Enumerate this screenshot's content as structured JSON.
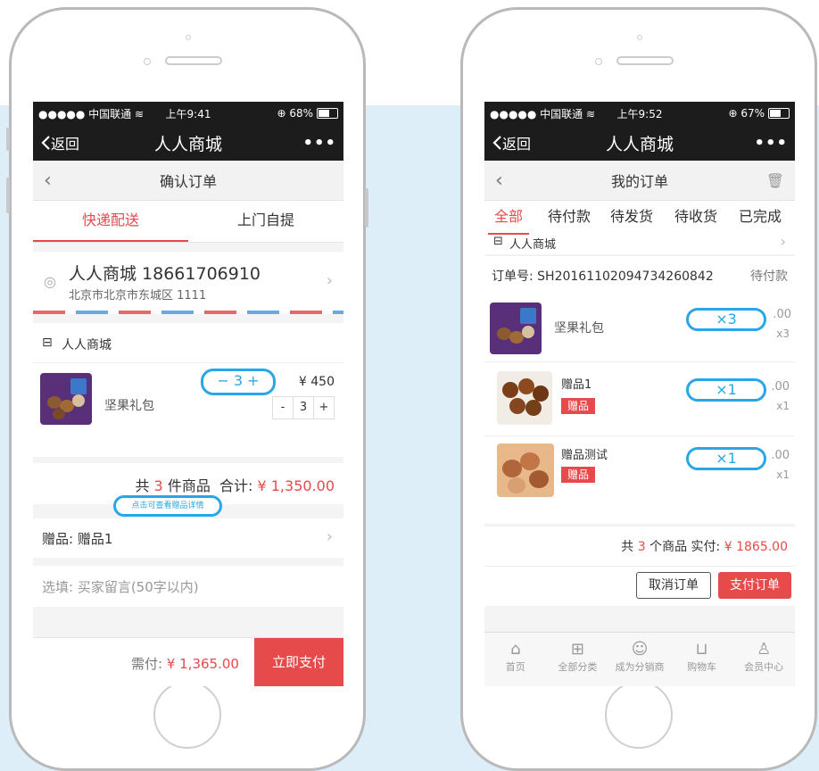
{
  "left": {
    "status": {
      "carrier": "●●●●● 中国联通 ≋",
      "time": "上午9:41",
      "battery": "⊕ 68%",
      "battery_level": 0.68
    },
    "nav": {
      "back": "返回",
      "title": "人人商城",
      "more": "•••"
    },
    "header": {
      "title": "确认订单"
    },
    "delivery_tabs": [
      "快递配送",
      "上门自提"
    ],
    "address": {
      "name_phone": "人人商城 18661706910",
      "detail": "北京市北京市东城区 1111"
    },
    "shop": {
      "name": "人人商城"
    },
    "product": {
      "name": "坚果礼包",
      "price": "¥ 450",
      "qty": "3",
      "minus": "-",
      "plus": "+"
    },
    "callout_qty": "− 3 +",
    "summary": {
      "prefix": "共 ",
      "count": "3",
      "suffix": " 件商品  合计: ",
      "total": "¥ 1,350.00"
    },
    "callout_gift": "点击可查看赠品详情",
    "gift": {
      "label": "赠品: 赠品1"
    },
    "message_placeholder": "选填: 买家留言(50字以内)",
    "footer": {
      "pay_label": "需付: ",
      "pay_amount": "¥ 1,365.00",
      "pay_button": "立即支付"
    }
  },
  "right": {
    "status": {
      "carrier": "●●●●● 中国联通 ≋",
      "time": "上午9:52",
      "battery": "⊕ 67%",
      "battery_level": 0.67
    },
    "nav": {
      "back": "返回",
      "title": "人人商城",
      "more": "•••"
    },
    "header": {
      "title": "我的订单"
    },
    "order_tabs": [
      "全部",
      "待付款",
      "待发货",
      "待收货",
      "已完成"
    ],
    "shop": {
      "name": "人人商城"
    },
    "order": {
      "number": "订单号: SH20161102094734260842",
      "status": "待付款"
    },
    "items": [
      {
        "name": "坚果礼包",
        "price": ".00",
        "qty": "x3",
        "callout": "×3",
        "tag": ""
      },
      {
        "name": "赠品1",
        "price": ".00",
        "qty": "x1",
        "callout": "×1",
        "tag": "赠品"
      },
      {
        "name": "赠品测试",
        "price": ".00",
        "qty": "x1",
        "callout": "×1",
        "tag": "赠品"
      }
    ],
    "summary": {
      "prefix": "共 ",
      "count": "3",
      "suffix": " 个商品 实付: ",
      "total": "¥ 1865.00"
    },
    "buttons": {
      "cancel": "取消订单",
      "pay": "支付订单"
    },
    "tabbar": [
      {
        "label": "首页",
        "icon": "home-icon"
      },
      {
        "label": "全部分类",
        "icon": "grid-icon"
      },
      {
        "label": "成为分销商",
        "icon": "users-icon"
      },
      {
        "label": "购物车",
        "icon": "cart-icon"
      },
      {
        "label": "会员中心",
        "icon": "user-icon"
      }
    ]
  },
  "colors": {
    "accent": "#e64a4a",
    "callout": "#29a6e6",
    "bar": "#1c1c1c",
    "background": "#ddeef8"
  }
}
